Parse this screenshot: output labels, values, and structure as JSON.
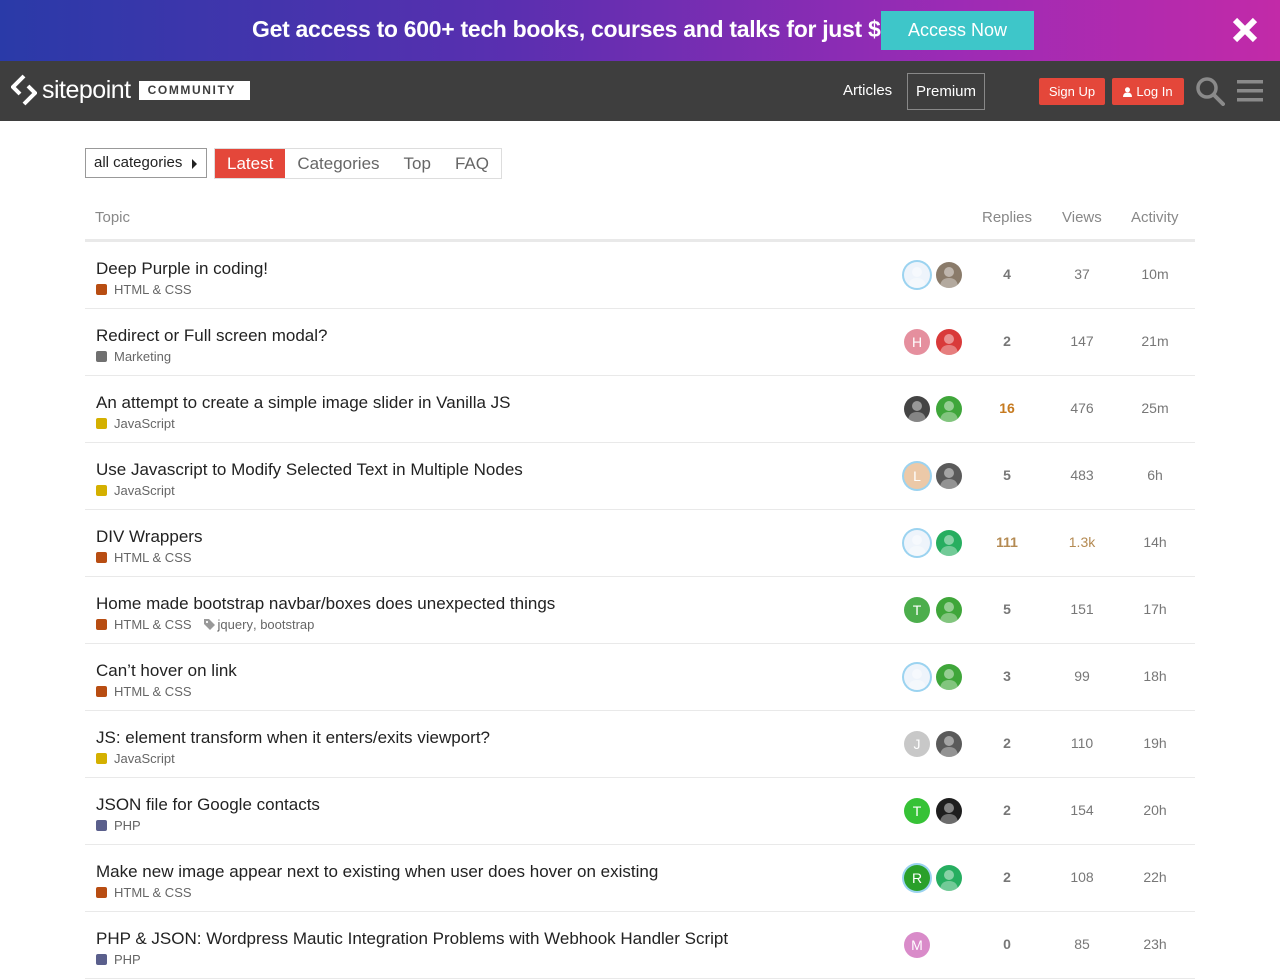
{
  "promo": {
    "glyph": "",
    "text": "Get access to 600+ tech books, courses and talks for just $6/m",
    "button": "Access Now"
  },
  "header": {
    "logo_word": "sitepoint",
    "logo_badge": "COMMUNITY",
    "nav": {
      "articles": "Articles",
      "premium": "Premium"
    },
    "signup": "Sign Up",
    "login": "Log In"
  },
  "filters": {
    "category_dropdown": "all categories",
    "tabs": [
      "Latest",
      "Categories",
      "Top",
      "FAQ"
    ],
    "active_tab": "Latest"
  },
  "table": {
    "headers": {
      "topic": "Topic",
      "replies": "Replies",
      "views": "Views",
      "activity": "Activity"
    },
    "rows": [
      {
        "title": "Deep Purple in coding!",
        "category": "HTML & CSS",
        "cat_color": "#b84d12",
        "tags": [],
        "avatars": [
          {
            "type": "img",
            "bg": "#eef4fb",
            "ring": true
          },
          {
            "type": "img",
            "bg": "#8a7b6a"
          }
        ],
        "replies": "4",
        "views": "37",
        "activity": "10m",
        "replies_style": "",
        "views_style": ""
      },
      {
        "title": "Redirect or Full screen modal?",
        "category": "Marketing",
        "cat_color": "#707070",
        "tags": [],
        "avatars": [
          {
            "type": "letter",
            "letter": "H",
            "bg": "#e58f9e"
          },
          {
            "type": "img",
            "bg": "#d93a3a"
          }
        ],
        "replies": "2",
        "views": "147",
        "activity": "21m",
        "replies_style": "",
        "views_style": ""
      },
      {
        "title": "An attempt to create a simple image slider in Vanilla JS",
        "category": "JavaScript",
        "cat_color": "#d4b000",
        "tags": [],
        "avatars": [
          {
            "type": "img",
            "bg": "#444444"
          },
          {
            "type": "img",
            "bg": "#3fa63a"
          }
        ],
        "replies": "16",
        "views": "476",
        "activity": "25m",
        "replies_style": "hot",
        "views_style": ""
      },
      {
        "title": "Use Javascript to Modify Selected Text in Multiple Nodes",
        "category": "JavaScript",
        "cat_color": "#d4b000",
        "tags": [],
        "avatars": [
          {
            "type": "letter",
            "letter": "L",
            "bg": "#ecc9a8",
            "ring": true
          },
          {
            "type": "img",
            "bg": "#5a5a5a"
          }
        ],
        "replies": "5",
        "views": "483",
        "activity": "6h",
        "replies_style": "",
        "views_style": ""
      },
      {
        "title": "DIV Wrappers",
        "category": "HTML & CSS",
        "cat_color": "#b84d12",
        "tags": [],
        "avatars": [
          {
            "type": "img",
            "bg": "#eef4fb",
            "ring": true
          },
          {
            "type": "img",
            "bg": "#27ae60"
          }
        ],
        "replies": "111",
        "views": "1.3k",
        "activity": "14h",
        "replies_style": "warm",
        "views_style": "warm"
      },
      {
        "title": "Home made bootstrap navbar/boxes does unexpected things",
        "category": "HTML & CSS",
        "cat_color": "#b84d12",
        "tags": [
          "jquery",
          "bootstrap"
        ],
        "avatars": [
          {
            "type": "letter",
            "letter": "T",
            "bg": "#4cae4c"
          },
          {
            "type": "img",
            "bg": "#3fa63a"
          }
        ],
        "replies": "5",
        "views": "151",
        "activity": "17h",
        "replies_style": "",
        "views_style": ""
      },
      {
        "title": "Can’t hover on link",
        "category": "HTML & CSS",
        "cat_color": "#b84d12",
        "tags": [],
        "avatars": [
          {
            "type": "img",
            "bg": "#eef4fb",
            "ring": true
          },
          {
            "type": "img",
            "bg": "#3fa63a"
          }
        ],
        "replies": "3",
        "views": "99",
        "activity": "18h",
        "replies_style": "",
        "views_style": ""
      },
      {
        "title": "JS: element transform when it enters/exits viewport?",
        "category": "JavaScript",
        "cat_color": "#d4b000",
        "tags": [],
        "avatars": [
          {
            "type": "letter",
            "letter": "J",
            "bg": "#c8c8c8"
          },
          {
            "type": "img",
            "bg": "#5a5a5a"
          }
        ],
        "replies": "2",
        "views": "110",
        "activity": "19h",
        "replies_style": "",
        "views_style": ""
      },
      {
        "title": "JSON file for Google contacts",
        "category": "PHP",
        "cat_color": "#5a5f8c",
        "tags": [],
        "avatars": [
          {
            "type": "letter",
            "letter": "T",
            "bg": "#36c236"
          },
          {
            "type": "img",
            "bg": "#1e1e1e"
          }
        ],
        "replies": "2",
        "views": "154",
        "activity": "20h",
        "replies_style": "",
        "views_style": ""
      },
      {
        "title": "Make new image appear next to existing when user does hover on existing",
        "category": "HTML & CSS",
        "cat_color": "#b84d12",
        "tags": [],
        "avatars": [
          {
            "type": "letter",
            "letter": "R",
            "bg": "#2aa02a",
            "ring": true
          },
          {
            "type": "img",
            "bg": "#27ae60"
          }
        ],
        "replies": "2",
        "views": "108",
        "activity": "22h",
        "replies_style": "",
        "views_style": ""
      },
      {
        "title": "PHP & JSON: Wordpress Mautic Integration Problems with Webhook Handler Script",
        "category": "PHP",
        "cat_color": "#5a5f8c",
        "tags": [],
        "avatars": [
          {
            "type": "letter",
            "letter": "M",
            "bg": "#d98bc9"
          }
        ],
        "replies": "0",
        "views": "85",
        "activity": "23h",
        "replies_style": "",
        "views_style": ""
      }
    ]
  }
}
